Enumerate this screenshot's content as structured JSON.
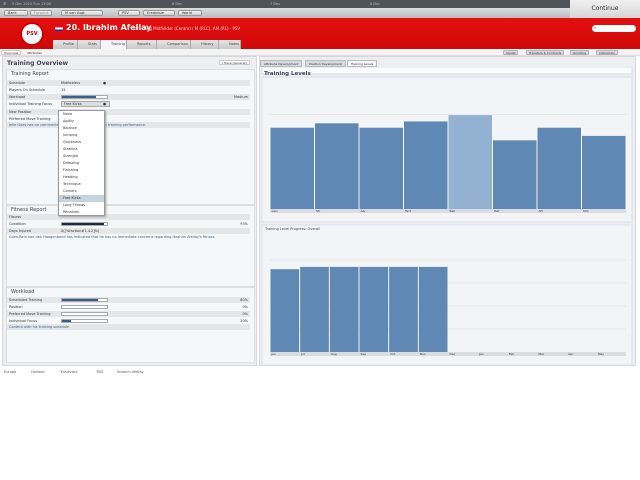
{
  "topbar": {
    "date": "5 Dec 2010 Sun 13:00",
    "days": [
      "6 Dec",
      "7 Dec",
      "8 Dec"
    ],
    "continue": "Continue"
  },
  "toolbar": {
    "back": "Back",
    "forward": "Forward",
    "manager": "M van Vugt",
    "club": "PSV",
    "league": "Eredivisie",
    "world": "World",
    "zoom": "Edit"
  },
  "header": {
    "number_name": "20. Ibrahim Afellay",
    "role": "Attacking Midfielder (Centre) / M (RLC), AM (RL) - PSV",
    "logo_text": "PSV",
    "search_placeholder": ""
  },
  "player_tabs": [
    {
      "label": "Profile"
    },
    {
      "label": "Stats"
    },
    {
      "label": "Training"
    },
    {
      "label": "Reports"
    },
    {
      "label": "Comparison"
    },
    {
      "label": "History"
    },
    {
      "label": "Notes"
    }
  ],
  "subnav": {
    "items": [
      "Overview",
      "Attributes"
    ],
    "right_buttons": [
      "Squad",
      "Transfers & Contracts",
      "Scouting",
      "Interaction"
    ]
  },
  "left": {
    "title": "Training Overview",
    "view_button": "I Have (General)",
    "training_report": {
      "heading": "Training Report",
      "rows": [
        {
          "label": "Schedule",
          "value": "Midfielders"
        },
        {
          "label": "Players On Schedule",
          "value": "15"
        },
        {
          "label": "Workload",
          "value": "Medium",
          "bar": 0.75
        },
        {
          "label": "Individual Training Focus",
          "value": "Free Kicks"
        },
        {
          "label": "New Position",
          "value": ""
        },
        {
          "label": "Preferred Move Training",
          "value": ""
        }
      ],
      "note": "Jelle Goes has no comments to make about the player's training performance."
    },
    "focus_options": [
      "None",
      "Agility",
      "Balance",
      "Jumping",
      "Quickness",
      "Stamina",
      "Strength",
      "Dribbling",
      "Finishing",
      "Heading",
      "Technique",
      "Corners",
      "Free Kicks",
      "Long Throws",
      "Penalties"
    ],
    "focus_selected": "Free Kicks",
    "fitness_report": {
      "heading": "Fitness Report",
      "rows": [
        {
          "label": "Fitness",
          "value": ""
        },
        {
          "label": "Condition",
          "value": "93%",
          "bar": 0.93
        },
        {
          "label": "Days Injured",
          "value": "0([%faction#1-4.2]%)"
        }
      ],
      "note": "Coen-Rein van den Hoogenband has indicated that he has no immediate concerns regarding Ibrahim Afellay's fitness."
    },
    "workload": {
      "heading": "Workload",
      "rows": [
        {
          "label": "Scheduled Training",
          "value": "80%",
          "bar": 0.8
        },
        {
          "label": "Position",
          "value": "0%",
          "bar": 0
        },
        {
          "label": "Preferred Move Training",
          "value": "0%",
          "bar": 0
        },
        {
          "label": "Individual Focus",
          "value": "20%",
          "bar": 0.2
        }
      ],
      "note": "Content with his training schedule"
    }
  },
  "right": {
    "tabs": [
      "Attribute Development",
      "Position Development",
      "Training Levels"
    ],
    "active_tab": "Training Levels"
  },
  "colors": {
    "header_red": "#d80a0a",
    "bar": "#5f88b5",
    "bar_highlight": "#93b1d0",
    "accent": "#3a5f8e"
  },
  "chart_data": [
    {
      "type": "bar",
      "title": "Training Levels",
      "categories": [
        "Gen",
        "Str",
        "Aer",
        "Tact",
        "Ball",
        "Def",
        "Att",
        "Sho"
      ],
      "values": [
        12.9,
        13.6,
        12.9,
        13.9,
        14.9,
        10.9,
        12.9,
        11.6
      ],
      "highlighted": "Ball",
      "ylim": [
        0,
        20
      ],
      "grid": true
    },
    {
      "type": "bar",
      "title": "Training Level Progress: Overall",
      "categories": [
        "Jun",
        "Jul",
        "Aug",
        "Sep",
        "Oct",
        "Nov",
        "Dec",
        "Jan",
        "Feb",
        "Mar",
        "Apr",
        "May"
      ],
      "values": [
        3.6,
        3.7,
        3.7,
        3.7,
        3.7,
        3.7,
        null,
        null,
        null,
        null,
        null,
        null
      ],
      "ylim": [
        0,
        5
      ],
      "grid": true
    }
  ],
  "breadcrumb": [
    "Europe",
    "Holland",
    "Eredivisie",
    "PSV",
    "Ibrahim Afellay"
  ]
}
